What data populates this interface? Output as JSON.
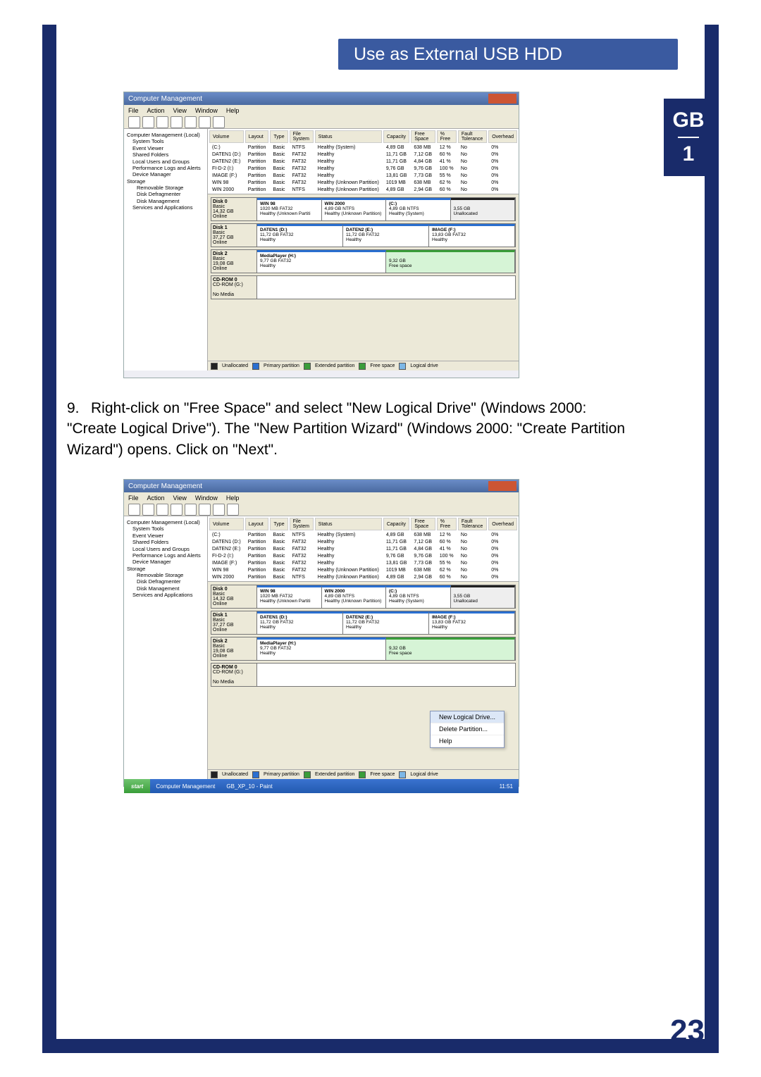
{
  "header_title": "Use as External USB HDD",
  "side_label_top": "GB",
  "side_label_num": "1",
  "page_number": "23",
  "instruction_number": "9.",
  "instruction_text": "Right-click on \"Free Space\" and select \"New Logical Drive\" (Windows 2000: \"Create Logical Drive\"). The \"New Partition Wizard\" (Windows 2000: \"Create Partition Wizard\") opens. Click on \"Next\".",
  "window": {
    "title": "Computer Management",
    "menu": [
      "File",
      "Action",
      "View",
      "Window",
      "Help"
    ]
  },
  "tree_items": [
    "Computer Management (Local)",
    "System Tools",
    "Event Viewer",
    "Shared Folders",
    "Local Users and Groups",
    "Performance Logs and Alerts",
    "Device Manager",
    "Storage",
    "Removable Storage",
    "Disk Defragmenter",
    "Disk Management",
    "Services and Applications"
  ],
  "vol_headers": [
    "Volume",
    "Layout",
    "Type",
    "File System",
    "Status",
    "Capacity",
    "Free Space",
    "% Free",
    "Fault Tolerance",
    "Overhead"
  ],
  "volumes1": [
    [
      "(C:)",
      "Partition",
      "Basic",
      "NTFS",
      "Healthy (System)",
      "4,89 GB",
      "638 MB",
      "12 %",
      "No",
      "0%"
    ],
    [
      "DATEN1 (D:)",
      "Partition",
      "Basic",
      "FAT32",
      "Healthy",
      "11,71 GB",
      "7,12 GB",
      "60 %",
      "No",
      "0%"
    ],
    [
      "DATEN2 (E:)",
      "Partition",
      "Basic",
      "FAT32",
      "Healthy",
      "11,71 GB",
      "4,84 GB",
      "41 %",
      "No",
      "0%"
    ],
    [
      "FI-D-2 (I:)",
      "Partition",
      "Basic",
      "FAT32",
      "Healthy",
      "9,76 GB",
      "9,76 GB",
      "100 %",
      "No",
      "0%"
    ],
    [
      "IMAGE (F:)",
      "Partition",
      "Basic",
      "FAT32",
      "Healthy",
      "13,81 GB",
      "7,73 GB",
      "55 %",
      "No",
      "0%"
    ],
    [
      "WIN 98",
      "Partition",
      "Basic",
      "FAT32",
      "Healthy (Unknown Partition)",
      "1019 MB",
      "638 MB",
      "62 %",
      "No",
      "0%"
    ],
    [
      "WIN 2000",
      "Partition",
      "Basic",
      "NTFS",
      "Healthy (Unknown Partition)",
      "4,89 GB",
      "2,94 GB",
      "60 %",
      "No",
      "0%"
    ]
  ],
  "volumes2": [
    [
      "(C:)",
      "Partition",
      "Basic",
      "NTFS",
      "Healthy (System)",
      "4,89 GB",
      "638 MB",
      "12 %",
      "No",
      "0%"
    ],
    [
      "DATEN1 (D:)",
      "Partition",
      "Basic",
      "FAT32",
      "Healthy",
      "11,71 GB",
      "7,12 GB",
      "60 %",
      "No",
      "0%"
    ],
    [
      "DATEN2 (E:)",
      "Partition",
      "Basic",
      "FAT32",
      "Healthy",
      "11,71 GB",
      "4,84 GB",
      "41 %",
      "No",
      "0%"
    ],
    [
      "FI-D-2 (I:)",
      "Partition",
      "Basic",
      "FAT32",
      "Healthy",
      "9,76 GB",
      "9,76 GB",
      "100 %",
      "No",
      "0%"
    ],
    [
      "IMAGE (F:)",
      "Partition",
      "Basic",
      "FAT32",
      "Healthy",
      "13,81 GB",
      "7,73 GB",
      "55 %",
      "No",
      "0%"
    ],
    [
      "WIN 98",
      "Partition",
      "Basic",
      "FAT32",
      "Healthy (Unknown Partition)",
      "1019 MB",
      "638 MB",
      "62 %",
      "No",
      "0%"
    ],
    [
      "WIN 2000",
      "Partition",
      "Basic",
      "NTFS",
      "Healthy (Unknown Partition)",
      "4,89 GB",
      "2,94 GB",
      "60 %",
      "No",
      "0%"
    ]
  ],
  "disks": {
    "d0": {
      "label": "Disk 0",
      "sub": "Basic\n14,32 GB\nOnline",
      "parts": [
        {
          "t": "WIN 98",
          "s": "1020 MB FAT32\nHealthy (Unknown Partiti"
        },
        {
          "t": "WIN 2000",
          "s": "4,89 GB NTFS\nHealthy (Unknown Partition)"
        },
        {
          "t": "(C:)",
          "s": "4,89 GB NTFS\nHealthy (System)"
        },
        {
          "t": "",
          "s": "3,55 GB\nUnallocated",
          "cls": "unalloc"
        }
      ]
    },
    "d1": {
      "label": "Disk 1",
      "sub": "Basic\n37,27 GB\nOnline",
      "parts": [
        {
          "t": "DATEN1 (D:)",
          "s": "11,72 GB FAT32\nHealthy"
        },
        {
          "t": "DATEN2 (E:)",
          "s": "11,72 GB FAT32\nHealthy"
        },
        {
          "t": "IMAGE (F:)",
          "s": "13,83 GB FAT32\nHealthy"
        }
      ]
    },
    "d2": {
      "label": "Disk 2",
      "sub": "Basic\n19,08 GB\nOnline",
      "parts": [
        {
          "t": "MediaPlayer (H:)",
          "s": "9,77 GB FAT32\nHealthy",
          "w": "50%"
        },
        {
          "t": "",
          "s": "9,32 GB\nFree space",
          "cls": "free",
          "w": "50%"
        }
      ]
    },
    "cd": {
      "label": "CD-ROM 0",
      "sub": "CD-ROM (G:)\n\nNo Media"
    }
  },
  "legend": [
    "Unallocated",
    "Primary partition",
    "Extended partition",
    "Free space",
    "Logical drive"
  ],
  "context_menu": [
    "New Logical Drive...",
    "Delete Partition...",
    "Help"
  ],
  "taskbar": {
    "start": "start",
    "apps": [
      "Computer Management",
      "GB_XP_10 - Paint"
    ],
    "clock": "11:51"
  }
}
